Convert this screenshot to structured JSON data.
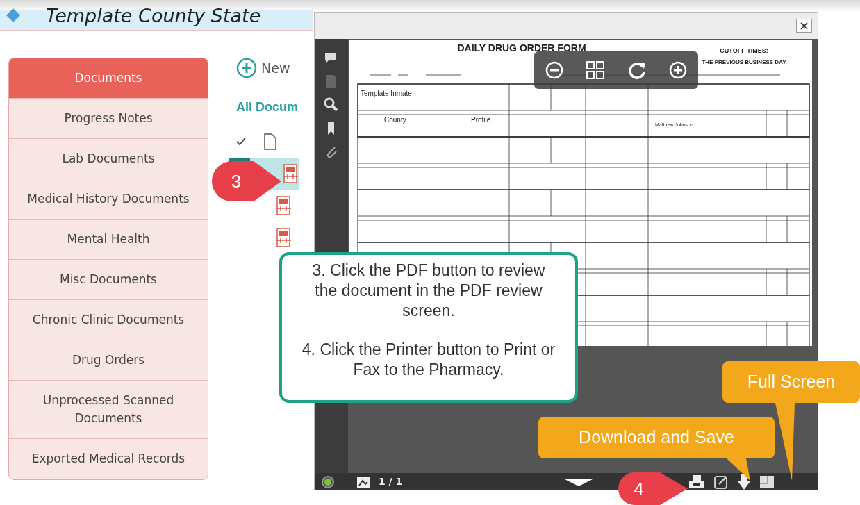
{
  "app": {
    "title": "Template County State"
  },
  "sidebar": {
    "items": [
      {
        "label": "Documents",
        "selected": true
      },
      {
        "label": "Progress Notes",
        "selected": false
      },
      {
        "label": "Lab Documents",
        "selected": false
      },
      {
        "label": "Medical History Documents",
        "selected": false
      },
      {
        "label": "Mental Health",
        "selected": false
      },
      {
        "label": "Misc Documents",
        "selected": false
      },
      {
        "label": "Chronic Clinic Documents",
        "selected": false
      },
      {
        "label": "Drug Orders",
        "selected": false
      },
      {
        "label": "Unprocessed Scanned Documents",
        "selected": false
      },
      {
        "label": "Exported Medical Records",
        "selected": false
      }
    ]
  },
  "documents": {
    "new_label": "New",
    "heading": "All Docum",
    "rows": [
      {
        "selected": true
      },
      {
        "selected": false
      },
      {
        "selected": false
      }
    ]
  },
  "viewer": {
    "close_label": "×",
    "form": {
      "title": "DAILY DRUG ORDER FORM",
      "cutoff_title": "CUTOFF TIMES:",
      "cutoff_line": "THE PREVIOUS BUSINESS DAY",
      "patient": "Template Inmate",
      "facility": "County",
      "order_type": "Profile",
      "prescriber": "Matthew Johnson"
    },
    "page_indicator": "1 / 1"
  },
  "callouts": [
    {
      "kind": "box",
      "paragraphs": [
        "3. Click the PDF button to review the document in the PDF review screen.",
        "4. Click the Printer button to Print or Fax to the Pharmacy."
      ]
    },
    {
      "kind": "tag",
      "text": "Full Screen"
    },
    {
      "kind": "tag",
      "text": "Download and Save"
    },
    {
      "kind": "marker",
      "text": "3"
    },
    {
      "kind": "marker",
      "text": "4"
    }
  ]
}
